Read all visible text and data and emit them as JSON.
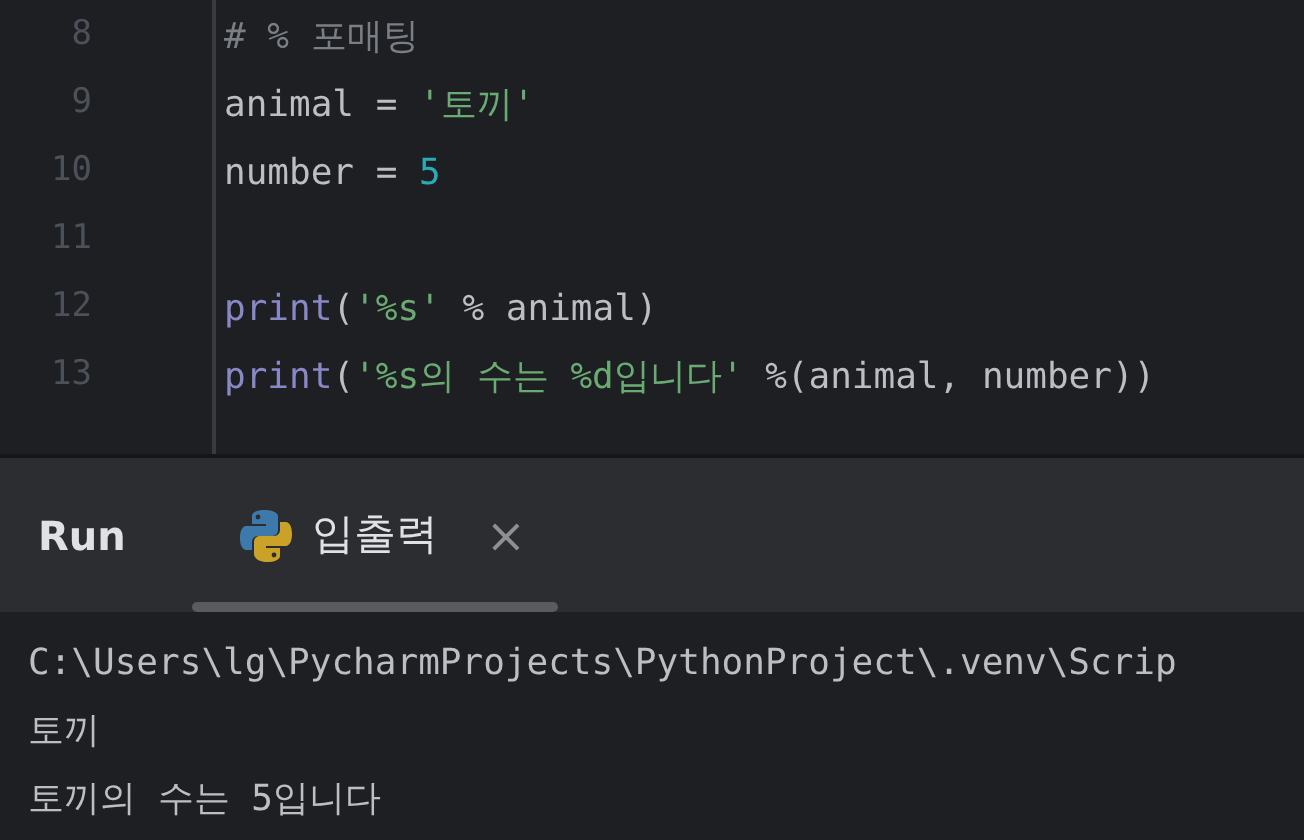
{
  "editor": {
    "lines": [
      {
        "number": "8",
        "tokens": [
          {
            "kind": "comment",
            "text": "# % 포매팅"
          }
        ]
      },
      {
        "number": "9",
        "tokens": [
          {
            "kind": "plain",
            "text": "animal = "
          },
          {
            "kind": "string",
            "text": "'토끼'"
          }
        ]
      },
      {
        "number": "10",
        "tokens": [
          {
            "kind": "plain",
            "text": "number = "
          },
          {
            "kind": "number",
            "text": "5"
          }
        ]
      },
      {
        "number": "11"
      },
      {
        "number": "12",
        "tokens": [
          {
            "kind": "builtin",
            "text": "print"
          },
          {
            "kind": "plain",
            "text": "("
          },
          {
            "kind": "string",
            "text": "'%s'"
          },
          {
            "kind": "plain",
            "text": " % animal)"
          }
        ]
      },
      {
        "number": "13",
        "tokens": [
          {
            "kind": "builtin",
            "text": "print"
          },
          {
            "kind": "plain",
            "text": "("
          },
          {
            "kind": "string",
            "text": "'%s의 수는 %d입니다'"
          },
          {
            "kind": "plain",
            "text": " %(animal, number))"
          }
        ]
      }
    ]
  },
  "run_panel": {
    "title": "Run",
    "tabs": [
      {
        "label": "입출력",
        "selected": true,
        "close": "×"
      }
    ],
    "output": [
      "C:\\Users\\lg\\PycharmProjects\\PythonProject\\.venv\\Scrip",
      "토끼",
      "토끼의 수는 5입니다"
    ]
  }
}
